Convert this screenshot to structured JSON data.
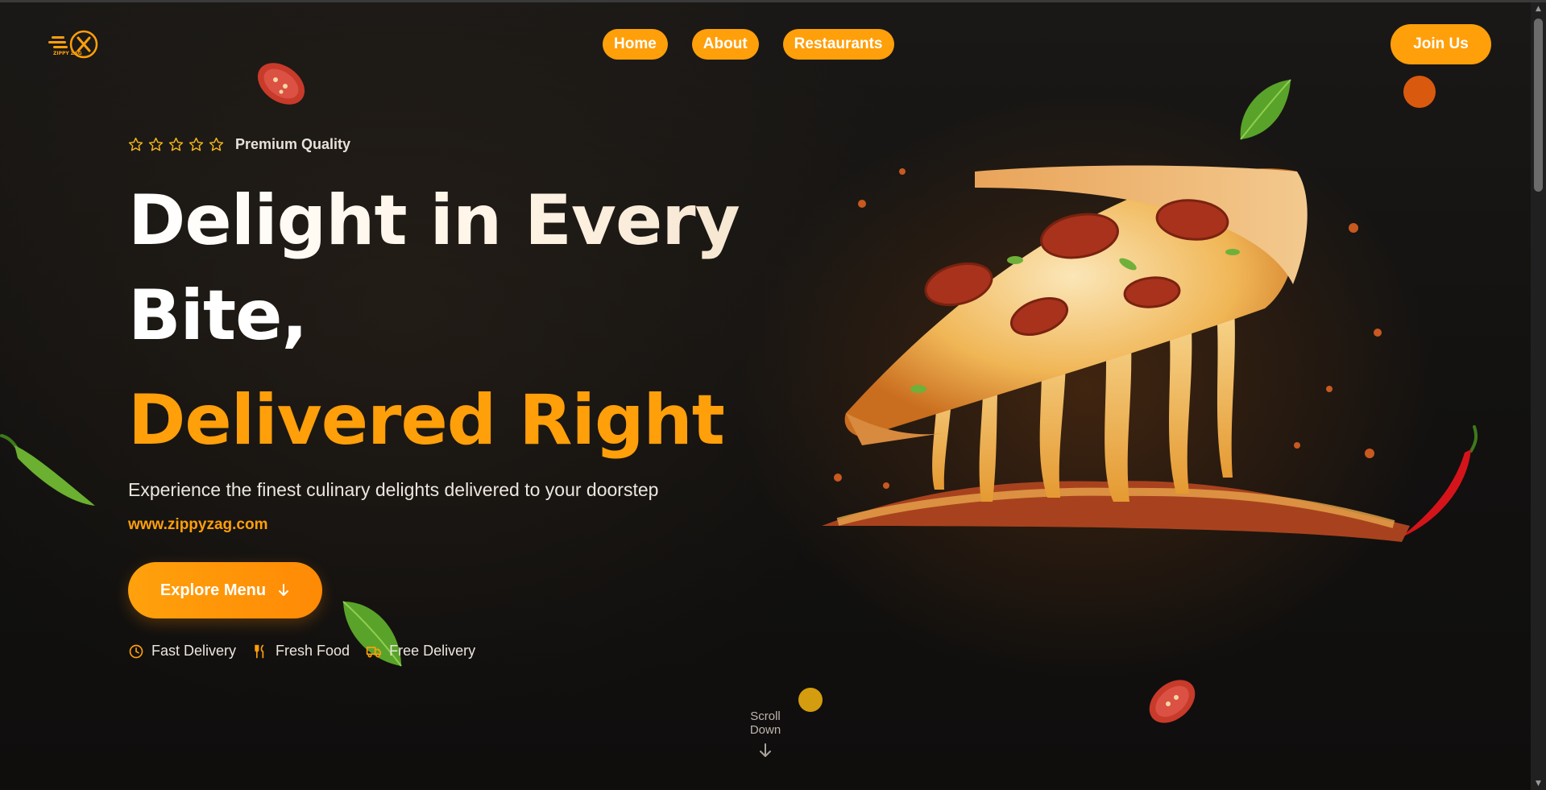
{
  "header": {
    "logo_text": "ZIPPY ZAG",
    "nav": [
      {
        "label": "Home"
      },
      {
        "label": "About"
      },
      {
        "label": "Restaurants"
      }
    ],
    "join_label": "Join Us"
  },
  "hero": {
    "rating_stars": 5,
    "rating_label": "Premium Quality",
    "headline_line1": "Delight in Every",
    "headline_line2": "Bite,",
    "headline_accent": "Delivered Right",
    "subtitle": "Experience the finest culinary delights delivered to your doorstep",
    "url": "www.zippyzag.com",
    "cta_label": "Explore Menu",
    "features": [
      {
        "icon": "clock-icon",
        "label": "Fast Delivery"
      },
      {
        "icon": "utensils-icon",
        "label": "Fresh Food"
      },
      {
        "icon": "truck-icon",
        "label": "Free Delivery"
      }
    ],
    "scroll_label": "Scroll Down"
  },
  "colors": {
    "accent": "#ff9f0a",
    "background": "#121110",
    "text": "#ffffff"
  }
}
